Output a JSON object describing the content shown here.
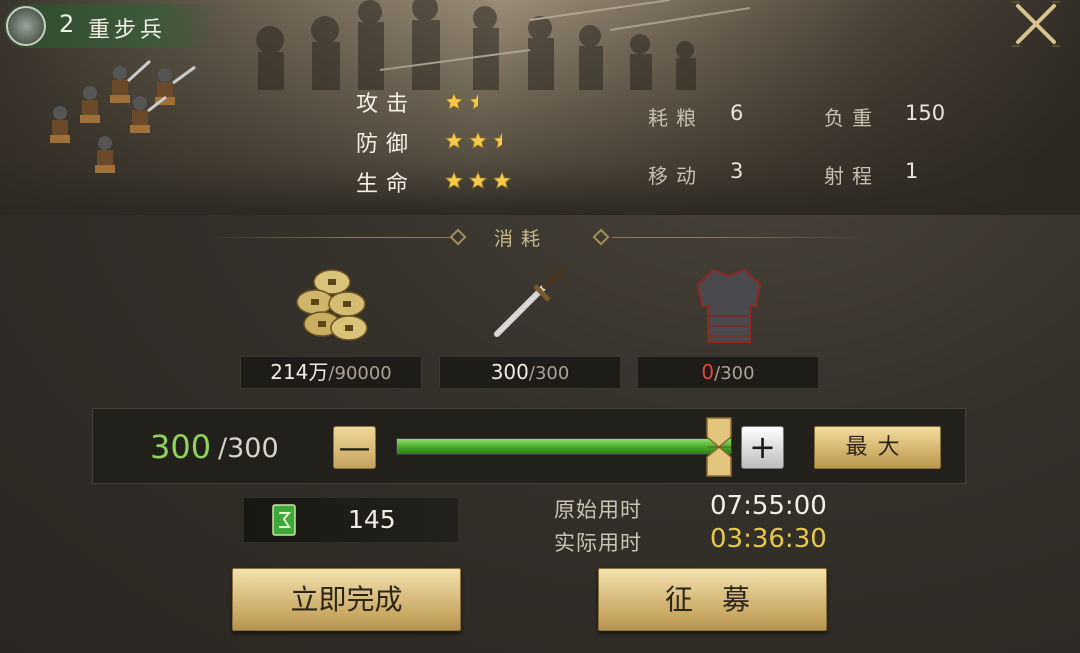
{
  "unit": {
    "level": "2",
    "name": "重步兵"
  },
  "stats": [
    {
      "label": "攻击",
      "stars": 1.5
    },
    {
      "label": "防御",
      "stars": 2.5
    },
    {
      "label": "生命",
      "stars": 3
    }
  ],
  "info": {
    "food_label": "耗粮",
    "food_value": "6",
    "load_label": "负重",
    "load_value": "150",
    "move_label": "移动",
    "move_value": "3",
    "range_label": "射程",
    "range_value": "1"
  },
  "consume": {
    "title": "消耗",
    "resources": [
      {
        "icon": "coins-icon",
        "have": "214万",
        "need": "/90000",
        "sufficient": true
      },
      {
        "icon": "sword-icon",
        "have": "300",
        "need": "/300",
        "sufficient": true
      },
      {
        "icon": "armor-icon",
        "have": "0",
        "need": "/300",
        "sufficient": false
      }
    ]
  },
  "quantity": {
    "current": "300",
    "max": "/300",
    "fraction": 1.0,
    "minus_symbol": "—",
    "plus_symbol": "+",
    "max_label": "最大"
  },
  "token": {
    "icon": "speedup-token-icon",
    "count": "145"
  },
  "times": {
    "original_label": "原始用时",
    "original_value": "07:55:00",
    "actual_label": "实际用时",
    "actual_value": "03:36:30"
  },
  "buttons": {
    "instant_label": "立即完成",
    "recruit_label": "征 募"
  },
  "colors": {
    "accent_green": "#8fd35a",
    "gold_text": "#e5c94a",
    "warn_red": "#e2453a",
    "button_gold": "#dcc286"
  }
}
